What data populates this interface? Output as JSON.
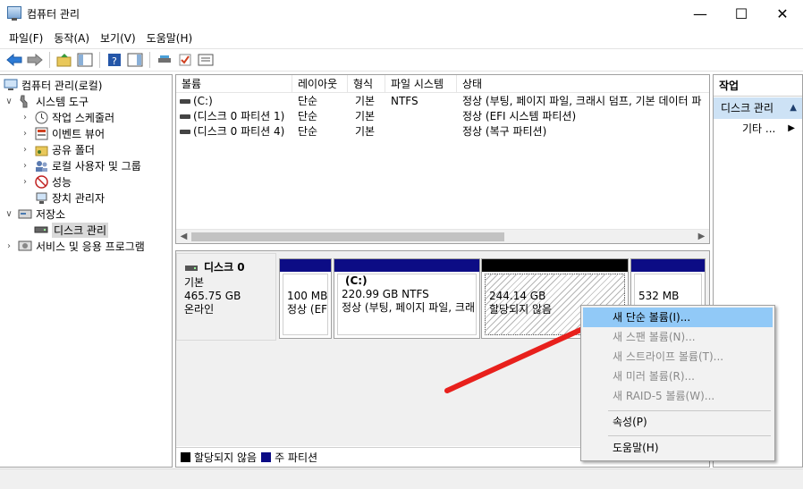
{
  "window": {
    "title": "컴퓨터 관리",
    "min": "—",
    "max": "☐",
    "close": "✕"
  },
  "menu": [
    "파일(F)",
    "동작(A)",
    "보기(V)",
    "도움말(H)"
  ],
  "tree": {
    "root": "컴퓨터 관리(로컬)",
    "system_tools": "시스템 도구",
    "task_scheduler": "작업 스케줄러",
    "event_viewer": "이벤트 뷰어",
    "shared_folders": "공유 폴더",
    "local_users": "로컬 사용자 및 그룹",
    "performance": "성능",
    "device_manager": "장치 관리자",
    "storage": "저장소",
    "disk_management": "디스크 관리",
    "services": "서비스 및 응용 프로그램"
  },
  "volumes": {
    "headers": [
      "볼륨",
      "레이아웃",
      "형식",
      "파일 시스템",
      "상태"
    ],
    "rows": [
      {
        "name": "(C:)",
        "layout": "단순",
        "type": "기본",
        "fs": "NTFS",
        "status": "정상 (부팅, 페이지 파일, 크래시 덤프, 기본 데이터 파"
      },
      {
        "name": "(디스크 0 파티션 1)",
        "layout": "단순",
        "type": "기본",
        "fs": "",
        "status": "정상 (EFI 시스템 파티션)"
      },
      {
        "name": "(디스크 0 파티션 4)",
        "layout": "단순",
        "type": "기본",
        "fs": "",
        "status": "정상 (복구 파티션)"
      }
    ]
  },
  "disk": {
    "name": "디스크 0",
    "type": "기본",
    "size": "465.75 GB",
    "state": "온라인",
    "partitions": [
      {
        "label": "",
        "size": "100 MB",
        "status": "정상 (EFI"
      },
      {
        "label": "(C:)",
        "size": "220.99 GB NTFS",
        "status": "정상 (부팅, 페이지 파일, 크래"
      },
      {
        "label": "",
        "size": "244.14 GB",
        "status": "할당되지 않음"
      },
      {
        "label": "",
        "size": "532 MB",
        "status": ""
      }
    ]
  },
  "legend": {
    "unallocated": "할당되지 않음",
    "primary": "주 파티션",
    "colors": {
      "unallocated": "#000000",
      "primary": "#0c0c85"
    }
  },
  "actions": {
    "header": "작업",
    "selected": "디스크 관리",
    "other": "기타 ..."
  },
  "context_menu": {
    "new_simple": "새 단순 볼륨(I)...",
    "new_spanned": "새 스팬 볼륨(N)...",
    "new_striped": "새 스트라이프 볼륨(T)...",
    "new_mirror": "새 미러 볼륨(R)...",
    "new_raid5": "새 RAID-5 볼륨(W)...",
    "properties": "속성(P)",
    "help": "도움말(H)"
  },
  "colors": {
    "highlight": "#91c9f7",
    "action_selected": "#cde2f5",
    "partition_bar": "#0c0c85",
    "annotation_arrow": "#e8201c"
  }
}
